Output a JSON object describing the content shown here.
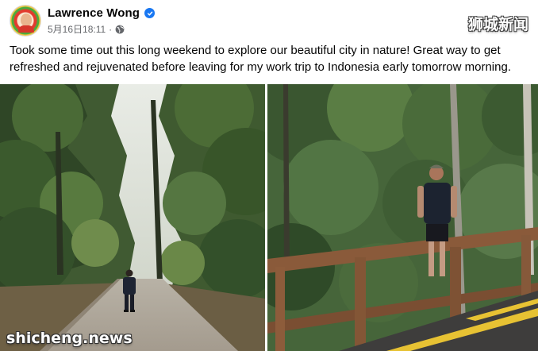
{
  "post": {
    "author": {
      "name": "Lawrence Wong",
      "verified": true,
      "avatar": "profile-photo"
    },
    "timestamp": "5月16日18:11",
    "meta_separator": "·",
    "audience_icon": "globe-icon",
    "text": "Took some time out this long weekend to explore our beautiful city in nature! Great way to get refreshed and rejuvenated before leaving for my work trip to Indonesia early tomorrow morning.",
    "photos": [
      {
        "name": "forest-road-photo"
      },
      {
        "name": "boardwalk-photo"
      }
    ]
  },
  "watermarks": {
    "top_right": "狮城新闻",
    "bottom_left": "shicheng.news"
  },
  "colors": {
    "verified_blue": "#1877f2",
    "meta_gray": "#65676b",
    "text": "#050505"
  }
}
